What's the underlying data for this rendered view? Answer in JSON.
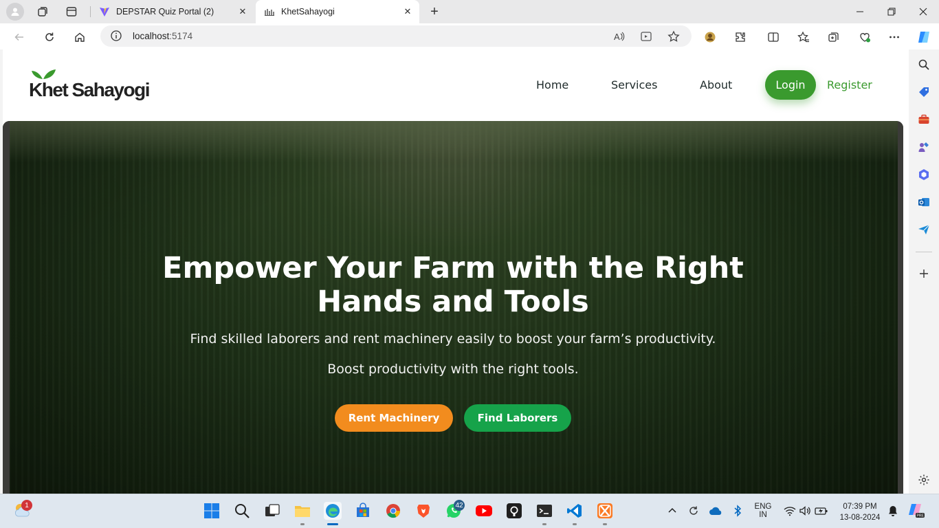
{
  "browser": {
    "tabs": [
      {
        "title": "DEPSTAR Quiz Portal (2)",
        "active": false
      },
      {
        "title": "KhetSahayogi",
        "active": true
      }
    ],
    "url_host": "localhost",
    "url_port": ":5174"
  },
  "site": {
    "logo_text": "Khet Sahayogi",
    "nav": {
      "home": "Home",
      "services": "Services",
      "about": "About",
      "login": "Login",
      "register": "Register"
    },
    "hero": {
      "title_line1": "Empower Your Farm with the Right",
      "title_line2": "Hands and Tools",
      "subtitle": "Find skilled laborers and rent machinery easily to boost your farm’s productivity.",
      "subtitle2": "Boost productivity with the right tools.",
      "cta_rent": "Rent Machinery",
      "cta_find": "Find Laborers"
    },
    "colors": {
      "brand_green": "#3a9a2e",
      "rent_orange": "#f28c1e",
      "find_green": "#16a34a"
    }
  },
  "taskbar": {
    "weather_badge": "1",
    "whatsapp_badge": "42",
    "lang_line1": "ENG",
    "lang_line2": "IN",
    "time": "07:39 PM",
    "date": "13-08-2024"
  }
}
